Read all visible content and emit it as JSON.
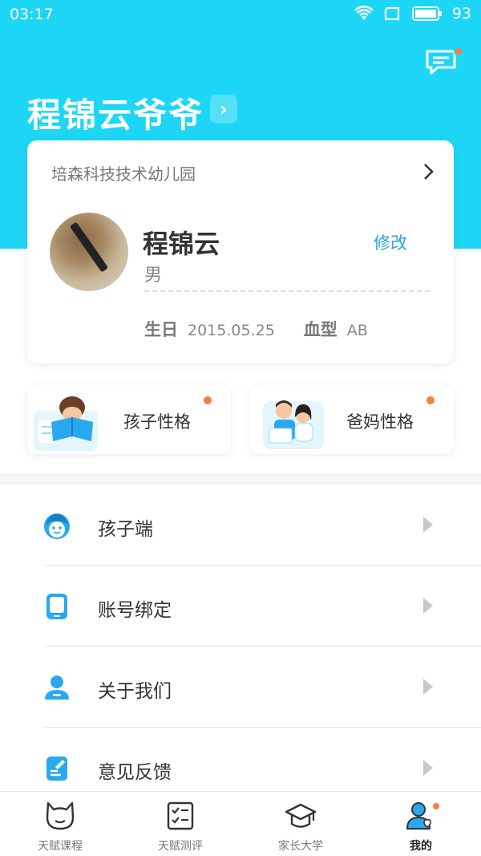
{
  "status_bar": {
    "time": "03:17",
    "battery": "93"
  },
  "header": {
    "title": "程锦云爷爷",
    "chevron": "›"
  },
  "profile": {
    "school": "培森科技技术幼儿园",
    "name": "程锦云",
    "gender": "男",
    "edit_label": "修改",
    "birthday_label": "生日",
    "birthday": "2015.05.25",
    "blood_type_label": "血型",
    "blood_type": "AB"
  },
  "personality": {
    "child_label": "孩子性格",
    "parent_label": "爸妈性格"
  },
  "menu": {
    "items": [
      {
        "label": "孩子端",
        "icon": "child-face-icon"
      },
      {
        "label": "账号绑定",
        "icon": "phone-icon"
      },
      {
        "label": "关于我们",
        "icon": "person-icon"
      },
      {
        "label": "意见反馈",
        "icon": "feedback-icon"
      }
    ]
  },
  "tabs": [
    {
      "label": "天赋课程",
      "icon": "cat-face-icon"
    },
    {
      "label": "天赋测评",
      "icon": "checklist-icon"
    },
    {
      "label": "家长大学",
      "icon": "graduation-cap-icon"
    },
    {
      "label": "我的",
      "icon": "profile-heart-icon",
      "active": true
    }
  ],
  "colors": {
    "accent": "#1dd6f5",
    "link": "#2aa5d8",
    "badge": "#ff7a45",
    "icon_blue": "#29a8f0"
  }
}
